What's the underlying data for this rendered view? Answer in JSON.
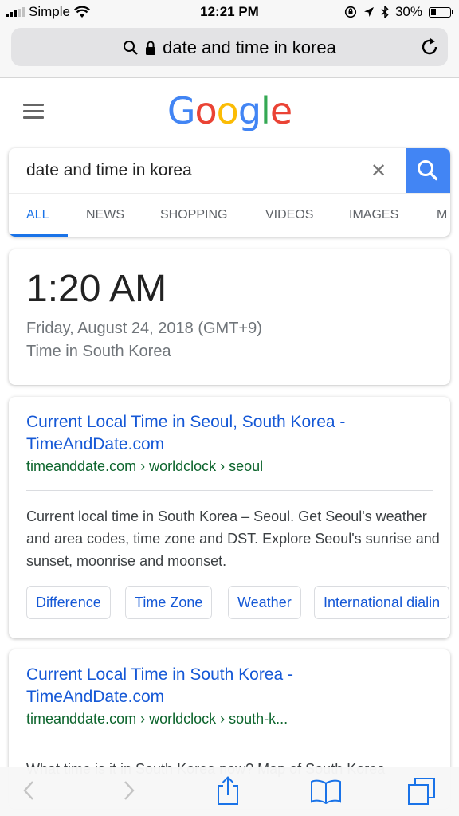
{
  "status_bar": {
    "carrier": "Simple",
    "time": "12:21 PM",
    "battery": "30%",
    "battery_level": 0.3
  },
  "address_bar": {
    "url_text": "date and time in korea"
  },
  "google": {
    "logo": [
      {
        "ch": "G",
        "color": "#4285F4"
      },
      {
        "ch": "o",
        "color": "#EA4335"
      },
      {
        "ch": "o",
        "color": "#FBBC05"
      },
      {
        "ch": "g",
        "color": "#4285F4"
      },
      {
        "ch": "l",
        "color": "#34A853"
      },
      {
        "ch": "e",
        "color": "#EA4335"
      }
    ]
  },
  "search": {
    "query": "date and time in korea",
    "clear": "✕"
  },
  "tabs": [
    "ALL",
    "NEWS",
    "SHOPPING",
    "VIDEOS",
    "IMAGES",
    "M"
  ],
  "time_card": {
    "time": "1:20 AM",
    "date": "Friday, August 24, 2018 (GMT+9)",
    "location": "Time in South Korea"
  },
  "results": [
    {
      "title_line1": "Current Local Time in Seoul, South Korea -",
      "title_line2": "TimeAndDate.com",
      "url": "timeanddate.com › worldclock › seoul",
      "snippet": "Current local time in South Korea – Seoul. Get Seoul's weather and area codes, time zone and DST. Explore Seoul's sunrise and sunset, moonrise and moonset.",
      "chips": [
        "Difference",
        "Time Zone",
        "Weather",
        "International dialin"
      ]
    },
    {
      "title_line1": "Current Local Time in South Korea -",
      "title_line2": "TimeAndDate.com",
      "url": "timeanddate.com › worldclock › south-k...",
      "snippet": "What time is it in South Korea now? Map of South Korea"
    }
  ]
}
